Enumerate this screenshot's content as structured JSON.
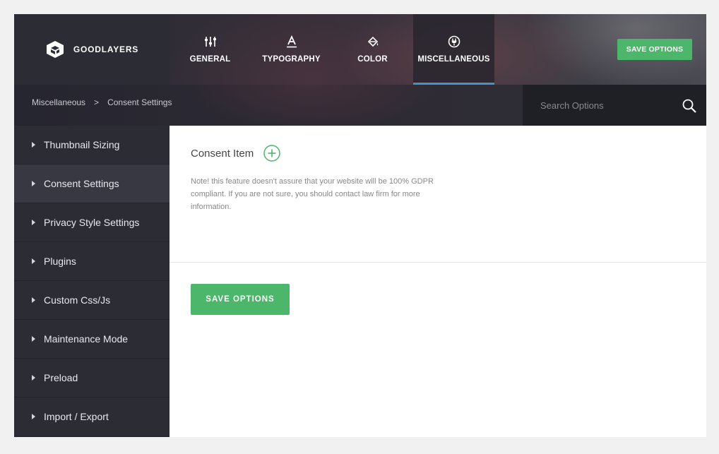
{
  "brand": {
    "name": "GOODLAYERS"
  },
  "tabs": [
    {
      "label": "GENERAL",
      "icon": "sliders-icon"
    },
    {
      "label": "TYPOGRAPHY",
      "icon": "font-icon"
    },
    {
      "label": "COLOR",
      "icon": "paint-bucket-icon"
    },
    {
      "label": "MISCELLANEOUS",
      "icon": "plug-icon",
      "active": true
    }
  ],
  "header": {
    "save_label": "SAVE OPTIONS"
  },
  "breadcrumb": {
    "parent": "Miscellaneous",
    "separator": ">",
    "current": "Consent Settings"
  },
  "search": {
    "placeholder": "Search Options",
    "value": ""
  },
  "sidebar": {
    "items": [
      {
        "label": "Thumbnail Sizing"
      },
      {
        "label": "Consent Settings",
        "active": true
      },
      {
        "label": "Privacy Style Settings"
      },
      {
        "label": "Plugins"
      },
      {
        "label": "Custom Css/Js"
      },
      {
        "label": "Maintenance Mode"
      },
      {
        "label": "Preload"
      },
      {
        "label": "Import / Export"
      }
    ]
  },
  "main": {
    "section_title": "Consent Item",
    "note": "Note! this feature doesn't assure that your website will be 100% GDPR compliant. If you are not sure, you should contact law firm for more information.",
    "save_label": "SAVE OPTIONS"
  },
  "colors": {
    "accent_green": "#4cb66a",
    "active_tab_underline": "#4a90c8",
    "sidebar_bg": "#2c2c35"
  }
}
